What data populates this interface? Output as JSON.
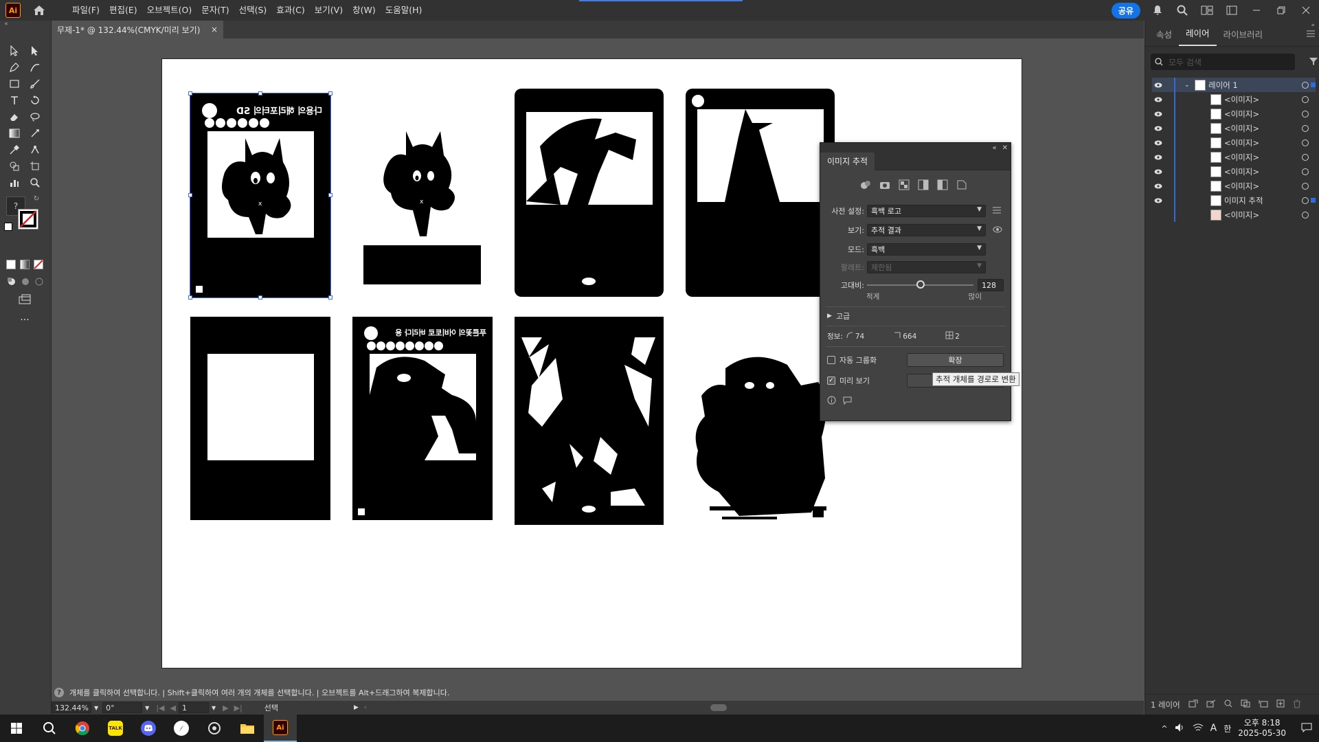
{
  "app": {
    "logo": "Ai",
    "menu": [
      "파일(F)",
      "편집(E)",
      "오브젝트(O)",
      "문자(T)",
      "선택(S)",
      "효과(C)",
      "보기(V)",
      "창(W)",
      "도움말(H)"
    ],
    "share_label": "공유"
  },
  "document": {
    "tab_title": "무제-1* @ 132.44%(CMYK/미리 보기)",
    "tab_close": "×"
  },
  "right_panel": {
    "tabs": [
      "속성",
      "레이어",
      "라이브러리"
    ],
    "active_tab": "레이어",
    "search_placeholder": "모두 검색",
    "layers": [
      {
        "name": "레이어 1",
        "level": 0
      },
      {
        "name": "<이미지>",
        "level": 1
      },
      {
        "name": "<이미지>",
        "level": 1
      },
      {
        "name": "<이미지>",
        "level": 1
      },
      {
        "name": "<이미지>",
        "level": 1
      },
      {
        "name": "<이미지>",
        "level": 1
      },
      {
        "name": "<이미지>",
        "level": 1
      },
      {
        "name": "<이미지>",
        "level": 1
      },
      {
        "name": "이미지 추적",
        "level": 1
      },
      {
        "name": "<이미지>",
        "level": 1
      }
    ],
    "layer_count": "1 레이어"
  },
  "trace_panel": {
    "title": "이미지 추적",
    "preset_label": "사전 설정:",
    "preset_value": "흑백 로고",
    "view_label": "보기:",
    "view_value": "추적 결과",
    "mode_label": "모드:",
    "mode_value": "흑백",
    "palette_label": "팔레트:",
    "palette_value": "제한됨",
    "threshold_label": "고대비:",
    "threshold_value": "128",
    "threshold_min": "적게",
    "threshold_max": "많이",
    "threshold_fraction": 0.5,
    "advanced_label": "고급",
    "info_label": "정보:",
    "info_paths": "74",
    "info_anchors": "664",
    "info_colors": "2",
    "auto_group_label": "자동 그룹화",
    "expand_label": "확장",
    "preview_label": "미리 보기",
    "tooltip": "추적 개체를 경로로 변환"
  },
  "artwork_text": {
    "card1_title": "다용의 해리포터의 SD",
    "card6_title": "푸른꽃의 어비토로 버리다 용"
  },
  "status": {
    "hint": "개체를 클릭하여 선택합니다. | Shift+클릭하여 여러 개의 개체를 선택합니다. | 오브젝트를 Alt+드래그하여 복제합니다.",
    "zoom": "132.44%",
    "rotate": "0°",
    "artboard": "1",
    "mode": "선택"
  },
  "taskbar": {
    "time": "오후 8:18",
    "date": "2025-05-30",
    "ime": "A",
    "ime2": "한"
  }
}
